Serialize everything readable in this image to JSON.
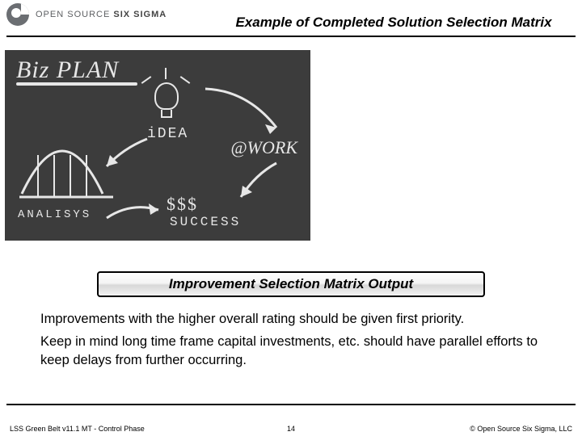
{
  "header": {
    "brand_open": "OPEN SOURCE",
    "brand_bold": "SIX SIGMA",
    "title": "Example of Completed Solution Selection Matrix"
  },
  "chalk": {
    "biz": "Biz PLAN",
    "idea": "iDEA",
    "work": "@WORK",
    "analysis": "ANALISYS",
    "money": "$$$",
    "success": "SUCCESS"
  },
  "output_bar": "Improvement Selection Matrix Output",
  "body": {
    "p1": "Improvements with the higher overall rating should be given first priority.",
    "p2": "Keep in mind long time frame capital investments, etc. should have parallel efforts to keep delays from further occurring."
  },
  "footer": {
    "left": "LSS Green Belt v11.1 MT - Control Phase",
    "center": "14",
    "right": "©  Open Source Six Sigma, LLC"
  }
}
